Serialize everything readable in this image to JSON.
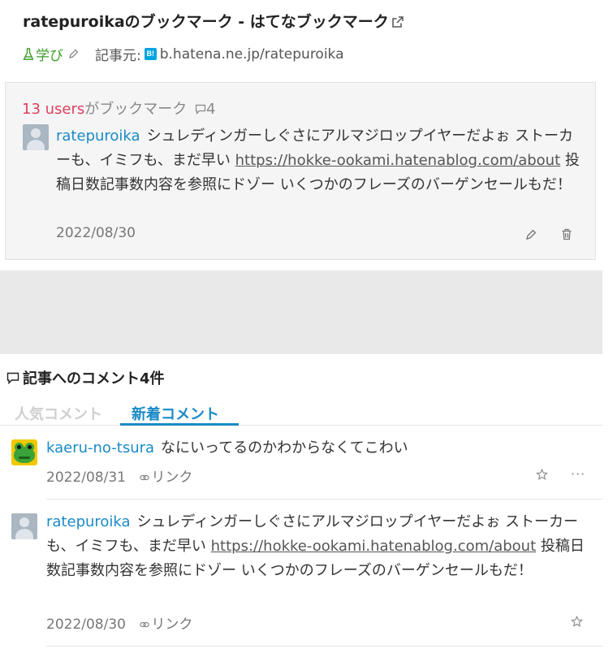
{
  "entry": {
    "title": "ratepuroikaのブックマーク - はてなブックマーク",
    "category": "学び",
    "source_label": "記事元:",
    "source_icon_text": "B!",
    "source_url": "b.hatena.ne.jp/ratepuroika"
  },
  "my_bookmark": {
    "users_count": "13 users",
    "users_suffix": "がブックマーク",
    "comment_count": "4",
    "user": "ratepuroika",
    "text_before": "シュレディンガーしぐさにアルマジロップイヤーだよぉ ストーカーも、イミフも、まだ早い ",
    "link": "https://hokke-ookami.hatenablog.com/about",
    "text_after": " 投稿日数記事数内容を参照にドゾー いくつかのフレーズのバーゲンセールもだ！",
    "date": "2022/08/30"
  },
  "comments_section": {
    "heading": "記事へのコメント4件",
    "tabs": {
      "popular": "人気コメント",
      "new": "新着コメント"
    },
    "link_label": "リンク",
    "more_label": "···",
    "items": [
      {
        "user": "kaeru-no-tsura",
        "text_before": "なにいってるのかわからなくてこわい",
        "link": "",
        "text_after": "",
        "date": "2022/08/31"
      },
      {
        "user": "ratepuroika",
        "text_before": "シュレディンガーしぐさにアルマジロップイヤーだよぉ ストーカーも、イミフも、まだ早い ",
        "link": "https://hokke-ookami.hatenablog.com/about",
        "text_after": " 投稿日数記事数内容を参照にドゾー いくつかのフレーズのバーゲンセールもだ！",
        "date": "2022/08/30"
      }
    ]
  },
  "colors": {
    "accent": "#1a8ac6",
    "users": "#e0405f",
    "category": "#3d9c2a"
  },
  "icons": [
    "external-link-icon",
    "flask-icon",
    "pencil-icon",
    "hatena-bookmark-icon",
    "comment-icon",
    "trash-icon",
    "link-icon",
    "star-icon",
    "more-icon",
    "avatar"
  ]
}
